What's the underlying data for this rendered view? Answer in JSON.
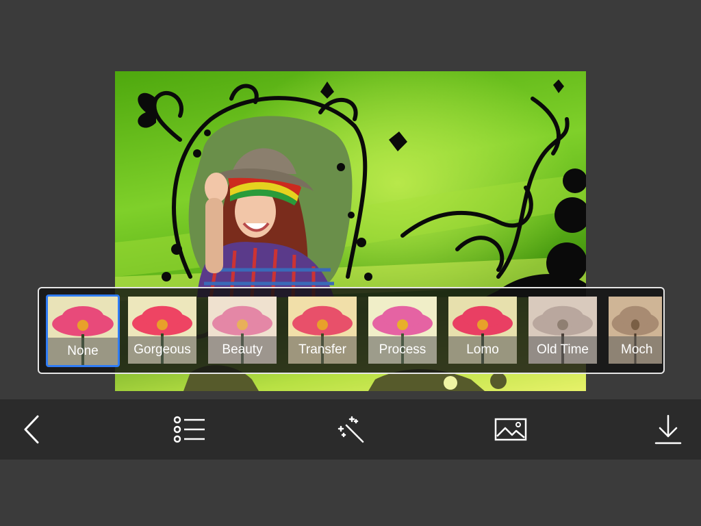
{
  "filters": [
    {
      "label": "None",
      "selected": true,
      "tone": "#e84a7a",
      "bg": "#e9e3b8"
    },
    {
      "label": "Gorgeous",
      "selected": false,
      "tone": "#ee4463",
      "bg": "#ede7bc"
    },
    {
      "label": "Beauty",
      "selected": false,
      "tone": "#e487a6",
      "bg": "#efe1cf"
    },
    {
      "label": "Transfer",
      "selected": false,
      "tone": "#e8506a",
      "bg": "#f1dfa9"
    },
    {
      "label": "Process",
      "selected": false,
      "tone": "#e563a3",
      "bg": "#f0eec8"
    },
    {
      "label": "Lomo",
      "selected": false,
      "tone": "#e93f63",
      "bg": "#e7e0ad"
    },
    {
      "label": "Old Time",
      "selected": false,
      "tone": "#b9a79e",
      "bg": "#d9cabd"
    },
    {
      "label": "Moch",
      "selected": false,
      "tone": "#a88b72",
      "bg": "#cfb596"
    }
  ],
  "toolbar": [
    {
      "name": "back-button",
      "icon": "chevron-left-icon"
    },
    {
      "name": "frames-list-button",
      "icon": "list-icon"
    },
    {
      "name": "magic-effects-button",
      "icon": "magic-wand-icon"
    },
    {
      "name": "gallery-button",
      "icon": "image-icon"
    },
    {
      "name": "save-button",
      "icon": "download-icon"
    }
  ],
  "colors": {
    "background": "#3b3b3b",
    "toolbar": "#2b2b2b",
    "selection": "#2f7cf6"
  }
}
